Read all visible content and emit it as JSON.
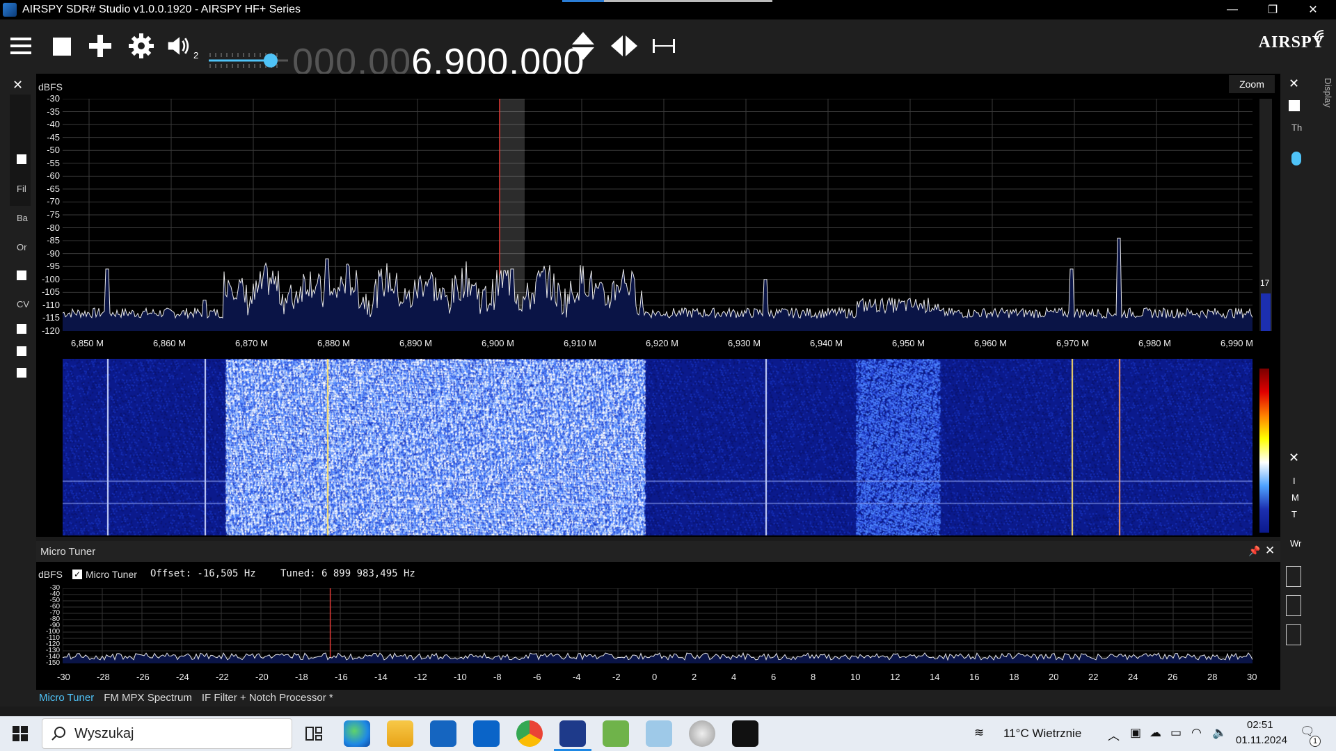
{
  "window": {
    "title": "AIRSPY SDR# Studio v1.0.0.1920 - AIRSPY HF+ Series",
    "minimize": "—",
    "restore": "❐",
    "close": "✕"
  },
  "toolbar": {
    "menu_icon": "menu-icon",
    "stop_icon": "stop-icon",
    "add_icon": "add-icon",
    "settings_icon": "gear-icon",
    "audio_icon": "speaker-icon",
    "audio_badge": "2",
    "volume_level": 0.78,
    "freq_dim": "000.00",
    "freq_lit": "6.900.000",
    "logo": "AIRSPY"
  },
  "left_panel": {
    "labels": [
      "Fil",
      "Ba",
      "Or",
      "CV"
    ]
  },
  "right_panel": {
    "tab_label": "Display",
    "label_th": "Th",
    "labels_lower": [
      "I",
      "M",
      "T"
    ],
    "label_wr": "Wr"
  },
  "spectrum": {
    "ylabel": "dBFS",
    "zoom_label": "Zoom",
    "level_value": "17",
    "y_ticks": [
      "-30",
      "-35",
      "-40",
      "-45",
      "-50",
      "-55",
      "-60",
      "-65",
      "-70",
      "-75",
      "-80",
      "-85",
      "-90",
      "-95",
      "-100",
      "-105",
      "-110",
      "-115",
      "-120"
    ],
    "x_ticks": [
      "6,850 M",
      "6,860 M",
      "6,870 M",
      "6,880 M",
      "6,890 M",
      "6,900 M",
      "6,910 M",
      "6,920 M",
      "6,930 M",
      "6,940 M",
      "6,950 M",
      "6,960 M",
      "6,970 M",
      "6,980 M",
      "6,990 M"
    ]
  },
  "micro_tuner": {
    "panel_title": "Micro Tuner",
    "ylabel": "dBFS",
    "checkbox_label": "Micro Tuner",
    "offset": "Offset: -16,505 Hz",
    "tuned": "Tuned: 6 899 983,495 Hz",
    "y_ticks": [
      "-30",
      "-40",
      "-50",
      "-60",
      "-70",
      "-80",
      "-90",
      "-100",
      "-110",
      "-120",
      "-130",
      "-140",
      "-150"
    ],
    "x_ticks": [
      "-30",
      "-28",
      "-26",
      "-24",
      "-22",
      "-20",
      "-18",
      "-16",
      "-14",
      "-12",
      "-10",
      "-8",
      "-6",
      "-4",
      "-2",
      "0",
      "2",
      "4",
      "6",
      "8",
      "10",
      "12",
      "14",
      "16",
      "18",
      "20",
      "22",
      "24",
      "26",
      "28",
      "30"
    ]
  },
  "bottom_tabs": [
    {
      "label": "Micro Tuner",
      "active": true
    },
    {
      "label": "FM MPX Spectrum",
      "active": false
    },
    {
      "label": "IF Filter + Notch Processor *",
      "active": false
    }
  ],
  "taskbar": {
    "search_placeholder": "Wyszukaj",
    "weather": "11°C  Wietrznie",
    "time": "02:51",
    "date": "01.11.2024",
    "notification_count": "1"
  },
  "colors": {
    "accent": "#4fc3f7",
    "spectrum_fill": "#0a1446",
    "waterfall_base": "#0b1a8c"
  }
}
